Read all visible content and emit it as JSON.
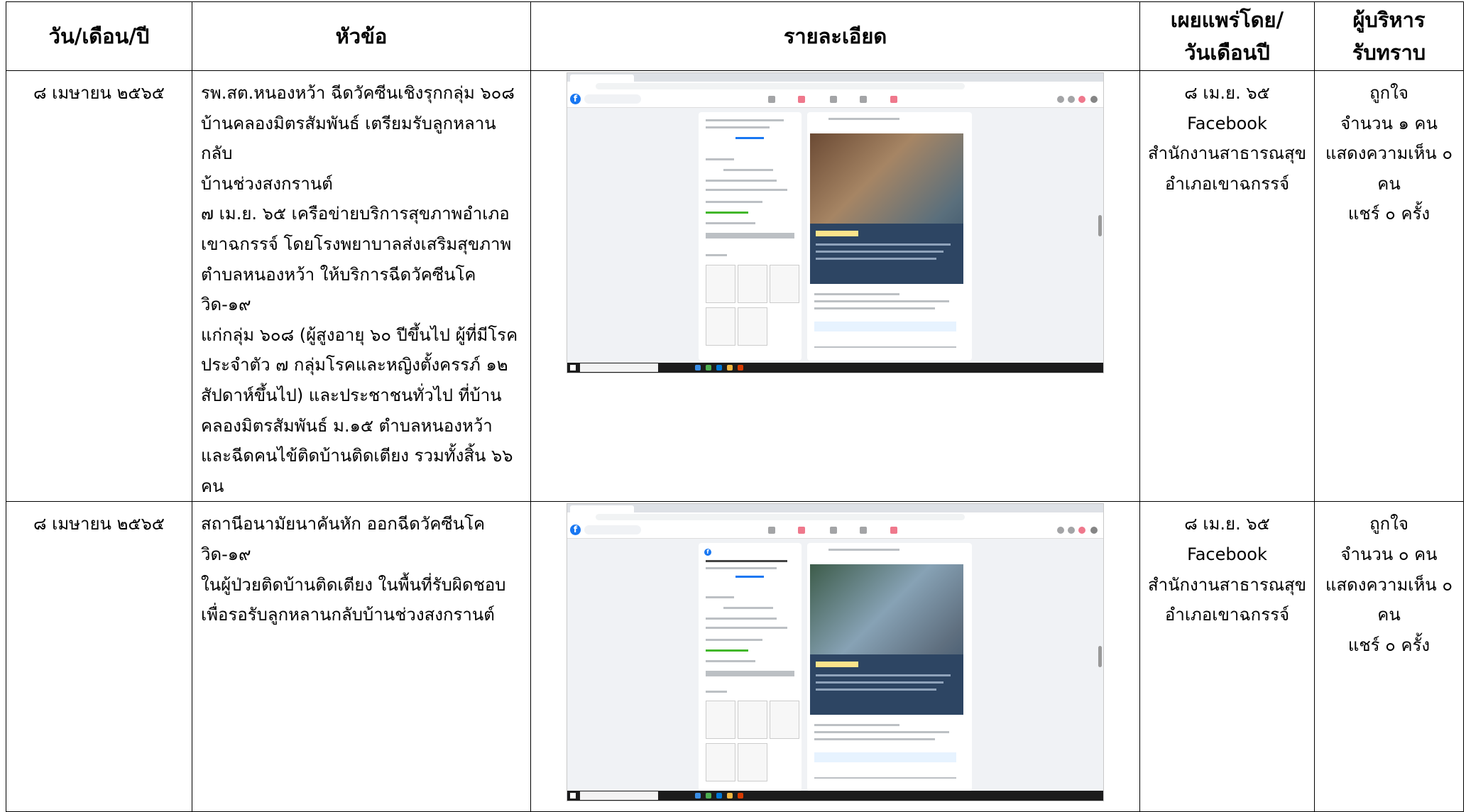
{
  "headers": {
    "date": "วัน/เดือน/ปี",
    "topic": "หัวข้อ",
    "detail": "รายละเอียด",
    "published": "เผยแพร่โดย/ วันเดือนปี",
    "admin": "ผู้บริหาร รับทราบ"
  },
  "rows": [
    {
      "date": "๘ เมษายน ๒๕๖๕",
      "topic_lines": [
        "รพ.สต.หนองหว้า ฉีดวัคซีนเชิงรุกกลุ่ม ๖๐๘",
        "บ้านคลองมิตรสัมพันธ์ เตรียมรับลูกหลานกลับ",
        "บ้านช่วงสงกรานต์",
        "๗ เม.ย. ๖๕ เครือข่ายบริการสุขภาพอำเภอ",
        "เขาฉกรรจ์ โดยโรงพยาบาลส่งเสริมสุขภาพ",
        "ตำบลหนองหว้า ให้บริการฉีดวัคซีนโควิด-๑๙",
        "แก่กลุ่ม ๖๐๘ (ผู้สูงอายุ ๖๐ ปีขึ้นไป ผู้ที่มีโรค",
        "ประจำตัว ๗ กลุ่มโรคและหญิงตั้งครรภ์ ๑๒",
        "สัปดาห์ขึ้นไป) และประชาชนทั่วไป ที่บ้าน",
        "คลองมิตรสัมพันธ์ ม.๑๕ ตำบลหนองหว้า",
        "และฉีดคนไข้ติดบ้านติดเตียง รวมทั้งสิ้น ๖๖",
        "คน"
      ],
      "published": [
        "๘ เม.ย. ๖๕",
        "Facebook",
        "สำนักงานสาธารณสุข",
        "อำเภอเขาฉกรรจ์"
      ],
      "admin": [
        "ถูกใจ",
        "จำนวน ๑ คน",
        "แสดงความเห็น ๐",
        "คน",
        "แชร์ ๐ ครั้ง"
      ]
    },
    {
      "date": "๘ เมษายน ๒๕๖๕",
      "topic_lines": [
        "สถานีอนามัยนาคันหัก ออกฉีดวัคซีนโควิด-๑๙",
        "ในผู้ป่วยติดบ้านติดเตียง ในพื้นที่รับผิดชอบ",
        "เพื่อรอรับลูกหลานกลับบ้านช่วงสงกรานต์"
      ],
      "published": [
        "๘ เม.ย. ๖๕",
        "Facebook",
        "สำนักงานสาธารณสุข",
        "อำเภอเขาฉกรรจ์"
      ],
      "admin": [
        "ถูกใจ",
        "จำนวน ๐ คน",
        "แสดงความเห็น ๐",
        "คน",
        "แชร์ ๐ ครั้ง"
      ]
    }
  ],
  "colors": {
    "facebook_blue": "#1877f2",
    "banner_navy": "#2d4563"
  },
  "icons": [
    "facebook-logo-icon",
    "windows-start-icon"
  ]
}
